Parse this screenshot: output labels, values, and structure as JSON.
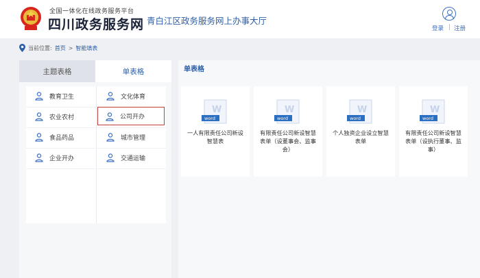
{
  "header": {
    "tagline": "全国一体化在线政务服务平台",
    "brand": "四川政务服务网",
    "hall": "青白江区政务服务网上办事大厅",
    "login": "登录",
    "separator": "|",
    "register": "注册"
  },
  "breadcrumb": {
    "prefix": "当前位置:",
    "home": "首页",
    "arrow": ">",
    "current": "智能填表"
  },
  "tabs": [
    {
      "label": "主题表格",
      "active": false
    },
    {
      "label": "单表格",
      "active": true
    }
  ],
  "categories": [
    {
      "label": "教育卫生",
      "selected": false,
      "icon": "user-icon"
    },
    {
      "label": "文化体育",
      "selected": false,
      "icon": "user-icon"
    },
    {
      "label": "农业农村",
      "selected": false,
      "icon": "user-icon"
    },
    {
      "label": "公司开办",
      "selected": true,
      "icon": "user-icon"
    },
    {
      "label": "食品药品",
      "selected": false,
      "icon": "user-icon"
    },
    {
      "label": "城市管理",
      "selected": false,
      "icon": "user-icon"
    },
    {
      "label": "企业开办",
      "selected": false,
      "icon": "user-icon"
    },
    {
      "label": "交通运输",
      "selected": false,
      "icon": "user-icon"
    }
  ],
  "main": {
    "section_title": "单表格",
    "docs": [
      {
        "badge": "word",
        "title": "一人有限责任公司新设智慧表"
      },
      {
        "badge": "word",
        "title": "有限责任公司新设智慧表单（设董事会、监事会）"
      },
      {
        "badge": "word",
        "title": "个人独资企业设立智慧表单"
      },
      {
        "badge": "word",
        "title": "有限责任公司新设智慧表单（设执行董事、监事）"
      }
    ]
  },
  "colors": {
    "accent": "#2d5fa8",
    "selected_border": "#c23b3b",
    "word_badge": "#2b6fc2"
  }
}
